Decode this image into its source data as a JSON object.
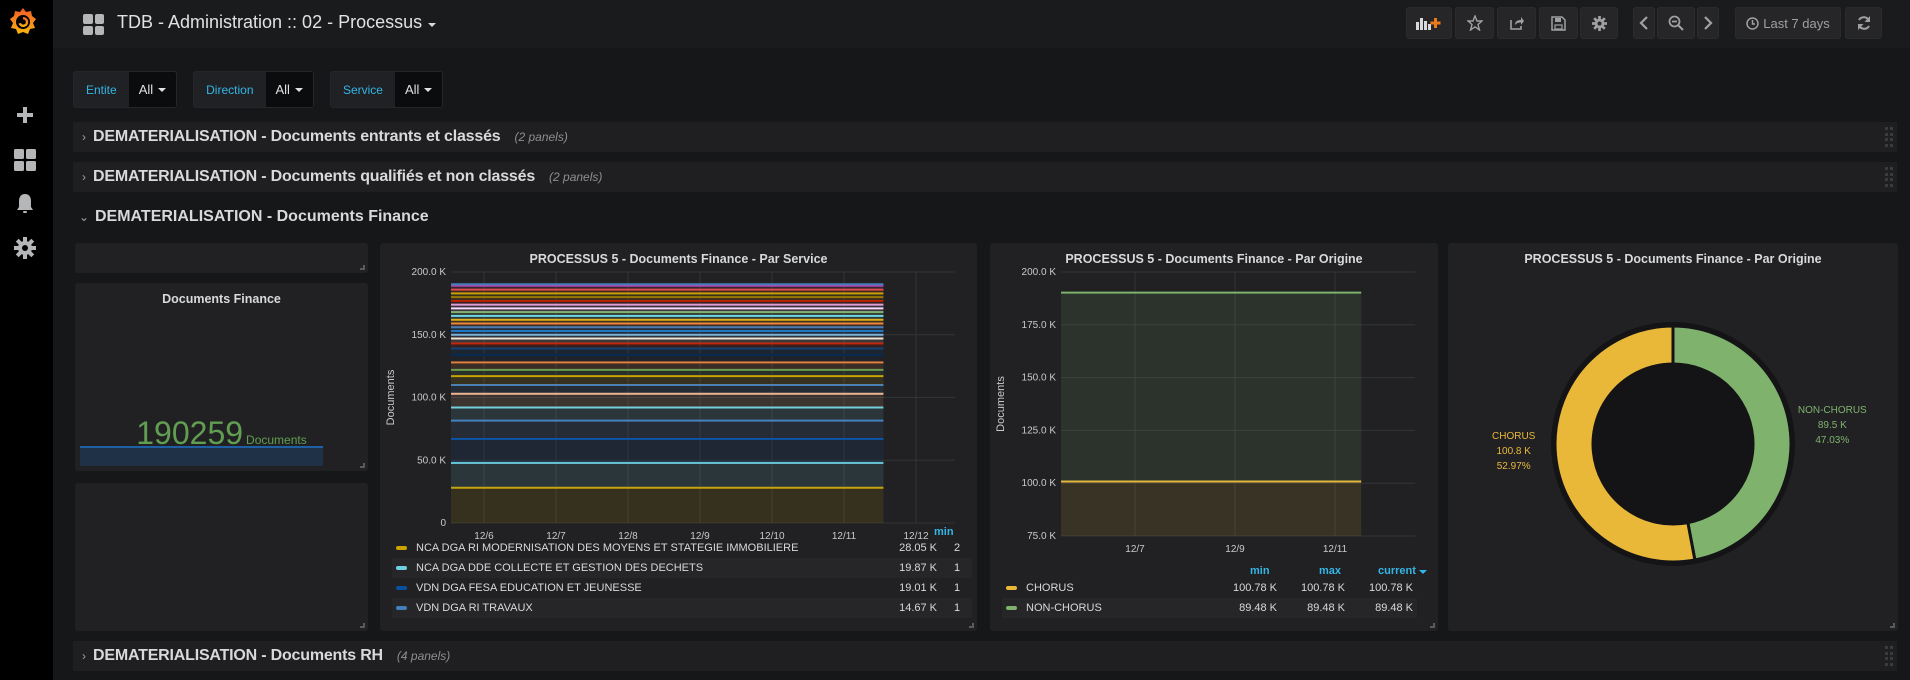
{
  "sidebar": {
    "items": [
      {
        "name": "create",
        "icon": "plus-icon"
      },
      {
        "name": "dashboards",
        "icon": "dashboards-icon"
      },
      {
        "name": "alerting",
        "icon": "bell-icon"
      },
      {
        "name": "configuration",
        "icon": "gear-icon"
      }
    ]
  },
  "header": {
    "title": "TDB - Administration :: 02 - Processus",
    "time_range": "Last 7 days",
    "buttons": [
      "add-panel",
      "star",
      "share",
      "save",
      "settings",
      "time-back",
      "zoom-out",
      "time-forward",
      "time-picker",
      "refresh"
    ]
  },
  "variables": [
    {
      "label": "Entite",
      "value": "All"
    },
    {
      "label": "Direction",
      "value": "All"
    },
    {
      "label": "Service",
      "value": "All"
    }
  ],
  "rows": [
    {
      "title": "DEMATERIALISATION - Documents entrants et classés",
      "count": "(2 panels)",
      "collapsed": true
    },
    {
      "title": "DEMATERIALISATION - Documents qualifiés et non classés",
      "count": "(2 panels)",
      "collapsed": true
    },
    {
      "title": "DEMATERIALISATION - Documents Finance",
      "count": "",
      "collapsed": false
    },
    {
      "title": "DEMATERIALISATION - Documents RH",
      "count": "(4 panels)",
      "collapsed": true
    }
  ],
  "stat_panel": {
    "title": "Documents Finance",
    "value": "190259",
    "unit": "Documents",
    "color": "#629e51"
  },
  "chart_data": [
    {
      "type": "area",
      "title": "PROCESSUS 5 - Documents Finance - Par Service",
      "xlabel": "",
      "ylabel": "Documents",
      "ylim": [
        0,
        200000
      ],
      "y_ticks": [
        "0",
        "50.0 K",
        "100.0 K",
        "150.0 K",
        "200.0 K"
      ],
      "x_ticks": [
        "12/6",
        "12/7",
        "12/8",
        "12/9",
        "12/10",
        "12/11",
        "12/12"
      ],
      "stacked": true,
      "stack_levels": [
        28050,
        47920,
        66930,
        81600,
        92000,
        103000,
        110000,
        117000,
        122000,
        128000,
        134000,
        139000,
        143000,
        147000,
        150000,
        153000,
        156000,
        159000,
        162000,
        165000,
        168000,
        171000,
        174000,
        177000,
        180000,
        183000,
        186000,
        189000,
        190259
      ],
      "stack_colors": [
        "#cca300",
        "#6ed0e0",
        "#0a50a1",
        "#447ebc",
        "#6ed0e0",
        "#f9ba8f",
        "#447ebc",
        "#cca300",
        "#629e51",
        "#ef843c",
        "#052b51",
        "#0a437c",
        "#bf1b00",
        "#f9e2d2",
        "#82b5d8",
        "#1f78c1",
        "#447ebc",
        "#ef843c",
        "#e5ac0e",
        "#70dbed",
        "#7eb26d",
        "#f9d9f9",
        "#e5a8e2",
        "#bf1b00",
        "#967302",
        "#cca300",
        "#e24d42",
        "#ba43a9",
        "#447ebc"
      ],
      "legend": {
        "columns": [
          "min"
        ],
        "series": [
          {
            "name": "NCA DGA RI MODERNISATION DES MOYENS ET STATEGIE IMMOBILIERE",
            "color": "#cca300",
            "min": "28.05 K",
            "next": "2"
          },
          {
            "name": "NCA DGA DDE COLLECTE ET GESTION DES DECHETS",
            "color": "#6ed0e0",
            "min": "19.87 K",
            "next": "1"
          },
          {
            "name": "VDN DGA FESA EDUCATION ET JEUNESSE",
            "color": "#0a50a1",
            "min": "19.01 K",
            "next": "1"
          },
          {
            "name": "VDN DGA RI TRAVAUX",
            "color": "#447ebc",
            "min": "14.67 K",
            "next": "1"
          }
        ]
      }
    },
    {
      "type": "area",
      "title": "PROCESSUS 5 - Documents Finance - Par Origine",
      "xlabel": "",
      "ylabel": "Documents",
      "ylim": [
        75000,
        200000
      ],
      "y_ticks": [
        "75.0 K",
        "100.0 K",
        "125.0 K",
        "150.0 K",
        "175.0 K",
        "200.0 K"
      ],
      "x_ticks": [
        "12/7",
        "12/9",
        "12/11"
      ],
      "stacked": true,
      "series": [
        {
          "name": "CHORUS",
          "color": "#eab839",
          "value": 100780,
          "min": "100.78 K",
          "max": "100.78 K",
          "current": "100.78 K"
        },
        {
          "name": "NON-CHORUS",
          "color": "#7eb26d",
          "value": 89480,
          "min": "89.48 K",
          "max": "89.48 K",
          "current": "89.48 K"
        }
      ],
      "legend": {
        "columns": [
          "min",
          "max",
          "current"
        ]
      }
    },
    {
      "type": "pie",
      "title": "PROCESSUS 5 - Documents Finance - Par Origine",
      "donut": true,
      "slices": [
        {
          "name": "NON-CHORUS",
          "value": 89500,
          "label": "89.5 K",
          "percent": "47.03%",
          "color": "#7eb26d"
        },
        {
          "name": "CHORUS",
          "value": 100800,
          "label": "100.8 K",
          "percent": "52.97%",
          "color": "#eab839"
        }
      ]
    }
  ]
}
